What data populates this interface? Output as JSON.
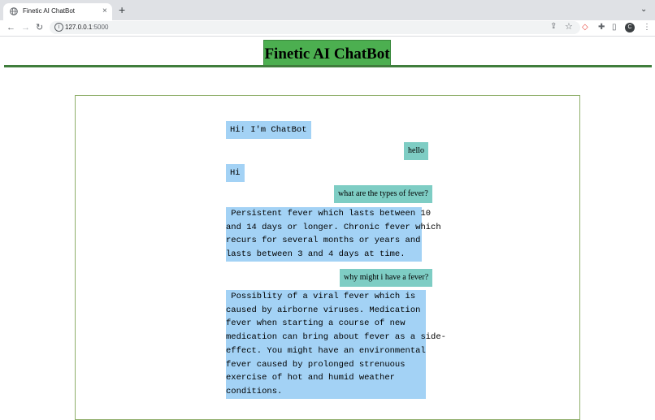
{
  "browser": {
    "tab_title": "Finetic AI ChatBot",
    "tab_close": "×",
    "new_tab": "+",
    "tab_menu": "⌄",
    "nav": {
      "back": "←",
      "forward": "→",
      "reload": "↻"
    },
    "url_host": "127.0.0.1",
    "url_port": ":5000",
    "avatar_letter": "C"
  },
  "page": {
    "title": "Finetic AI ChatBot"
  },
  "chat": {
    "messages": [
      {
        "sender": "bot",
        "text": "Hi! I'm ChatBot"
      },
      {
        "sender": "user",
        "text": "hello"
      },
      {
        "sender": "bot",
        "text": "Hi"
      },
      {
        "sender": "user",
        "text": "what are the types of fever?"
      },
      {
        "sender": "bot",
        "lines": [
          " Persistent fever which lasts between 10",
          "and 14 days or longer. Chronic fever which",
          "recurs for several months or years and",
          "lasts between 3 and 4 days at time."
        ]
      },
      {
        "sender": "user",
        "text": "why might i have a fever?"
      },
      {
        "sender": "bot",
        "lines": [
          " Possiblity of a viral fever which is",
          "caused by airborne viruses. Medication",
          "fever when starting a course of new",
          "medication can bring about fever as a side-",
          "effect. You might have an environmental",
          "fever caused by prolonged strenuous",
          "exercise of hot and humid weather",
          "conditions."
        ]
      }
    ]
  }
}
